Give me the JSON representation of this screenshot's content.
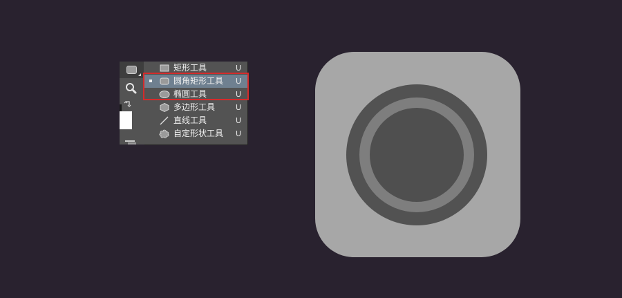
{
  "tool_flyout": {
    "items": [
      {
        "label": "矩形工具",
        "shortcut": "U",
        "icon": "rectangle-icon",
        "selected": false
      },
      {
        "label": "圆角矩形工具",
        "shortcut": "U",
        "icon": "rounded-rectangle-icon",
        "selected": true
      },
      {
        "label": "椭圆工具",
        "shortcut": "U",
        "icon": "ellipse-icon",
        "selected": false
      },
      {
        "label": "多边形工具",
        "shortcut": "U",
        "icon": "polygon-icon",
        "selected": false
      },
      {
        "label": "直线工具",
        "shortcut": "U",
        "icon": "line-icon",
        "selected": false
      },
      {
        "label": "自定形状工具",
        "shortcut": "U",
        "icon": "custom-shape-icon",
        "selected": false
      }
    ]
  },
  "toolbar": {
    "active_tool_icon": "rounded-rectangle-icon",
    "zoom_tool_icon": "zoom-icon",
    "swap_icon": "swap-colors-icon"
  },
  "colors": {
    "background": "#29222f",
    "panel": "#535353",
    "selected_row": "#6f8090",
    "highlight_border": "#d42b2b",
    "icon_body": "#a7a7a7",
    "lens_outer": "#525252",
    "lens_ring": "#7e7e7e",
    "lens_inner": "#4f4f4f"
  }
}
